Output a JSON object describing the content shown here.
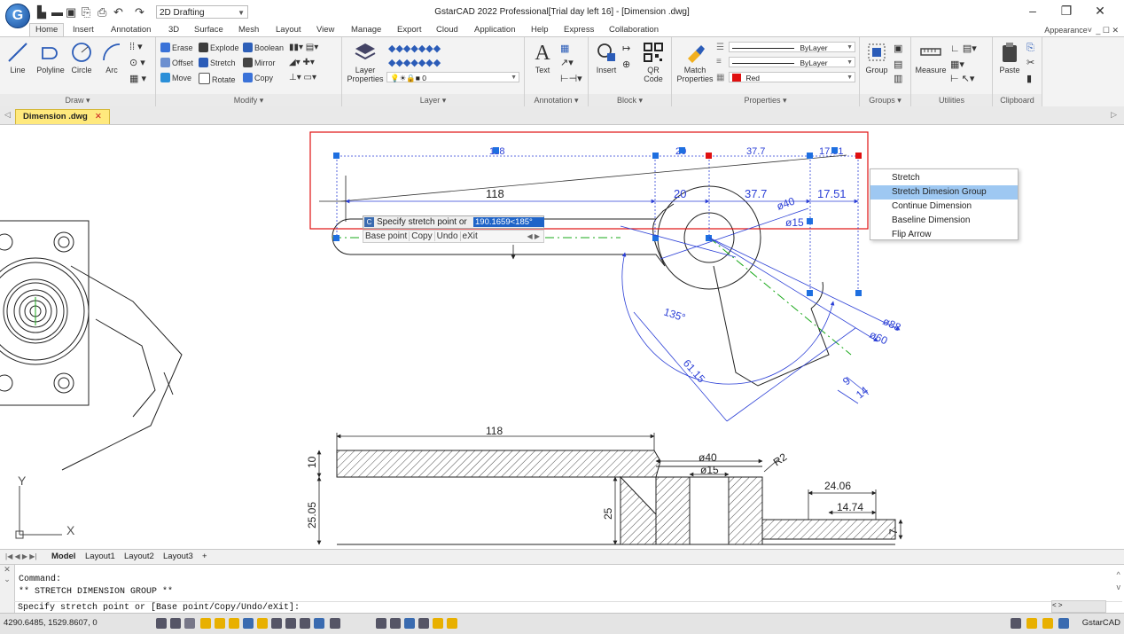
{
  "window": {
    "title": "GstarCAD 2022 Professional[Trial day left 16] - [Dimension .dwg]",
    "app_logo": "G",
    "workspace": "2D Drafting",
    "controls": [
      "–",
      "❐",
      "✕"
    ]
  },
  "quick_access": [
    "new-icon",
    "open-icon",
    "save-icon",
    "saveas-icon",
    "print-icon",
    "undo-icon",
    "redo-icon"
  ],
  "ribbon_tabs": [
    "Home",
    "Insert",
    "Annotation",
    "3D",
    "Surface",
    "Mesh",
    "Layout",
    "View",
    "Manage",
    "Export",
    "Cloud",
    "Application",
    "Help",
    "Express",
    "Collaboration"
  ],
  "appearance": "Appearance˅",
  "ribbon_winctl": "_ ☐ ✕",
  "ribbon": {
    "draw": {
      "label": "Draw ▾",
      "buttons": [
        "Line",
        "Polyline",
        "Circle",
        "Arc"
      ]
    },
    "modify": {
      "label": "Modify ▾",
      "rows": [
        [
          "Erase",
          "Explode",
          "Boolean"
        ],
        [
          "Offset",
          "Stretch",
          "Mirror"
        ],
        [
          "Move",
          "Rotate",
          "Copy"
        ]
      ]
    },
    "layer": {
      "label": "Layer ▾",
      "button": "Layer Properties",
      "current": "0"
    },
    "annotation": {
      "label": "Annotation ▾",
      "button": "Text"
    },
    "block": {
      "label": "Block ▾",
      "buttons": [
        "Insert",
        "QR Code"
      ]
    },
    "properties": {
      "label": "Properties ▾",
      "button": "Match Properties",
      "linetype": "ByLayer",
      "lineweight": "ByLayer",
      "color": "Red"
    },
    "groups": {
      "label": "Groups ▾",
      "button": "Group"
    },
    "utilities": {
      "label": "Utilities",
      "button": "Measure"
    },
    "clipboard": {
      "label": "Clipboard",
      "button": "Paste"
    }
  },
  "doc_tab": {
    "label": "Dimension .dwg",
    "close": "✕"
  },
  "drawing": {
    "dims_top": [
      "118",
      "20",
      "37.7",
      "17.51"
    ],
    "dims_ghost": [
      "118",
      "20",
      "37.7",
      "17.51"
    ],
    "dia": [
      "ø40",
      "ø15",
      "ø88",
      "ø60"
    ],
    "angle": "135°",
    "aligned": [
      "61.15",
      "9",
      "14"
    ],
    "bottom": [
      "118",
      "ø40",
      "ø15",
      "R2",
      "24.06",
      "14.74",
      "10",
      "25.05",
      "25",
      "7"
    ],
    "axis_y": "Y",
    "axis_x": "X"
  },
  "prompt": {
    "icon": "C",
    "text": "Specify stretch point or",
    "value": "190.1659<185°",
    "options": [
      "Base point",
      "Copy",
      "Undo",
      "eXit"
    ],
    "nav": "◀ ▶"
  },
  "context_menu": {
    "items": [
      "Stretch",
      "Stretch Dimesion Group",
      "Continue Dimension",
      "Baseline Dimension",
      "Flip Arrow"
    ],
    "highlighted": 1
  },
  "layout_tabs": {
    "nav": "|◀ ◀ ▶ ▶|",
    "tabs": [
      "Model",
      "Layout1",
      "Layout2",
      "Layout3",
      "+"
    ]
  },
  "command": {
    "lines": [
      "Command:",
      "** STRETCH DIMENSION GROUP **"
    ],
    "input": "Specify stretch point or [Base point/Copy/Undo/eXit]:",
    "side": [
      "✕",
      "⌄"
    ],
    "scroll": [
      "^",
      "v"
    ],
    "hscroll": "<  >"
  },
  "status": {
    "coords": "4290.6485, 1529.8607, 0",
    "right": "GstarCAD"
  },
  "colors": {
    "accent": "#1f64c8",
    "dim_blue": "#2b3fd6",
    "selection_red": "#e01010",
    "grip_blue": "#1e6fe0",
    "centerline_green": "#18a818",
    "tab_yellow": "#ffe97d"
  }
}
